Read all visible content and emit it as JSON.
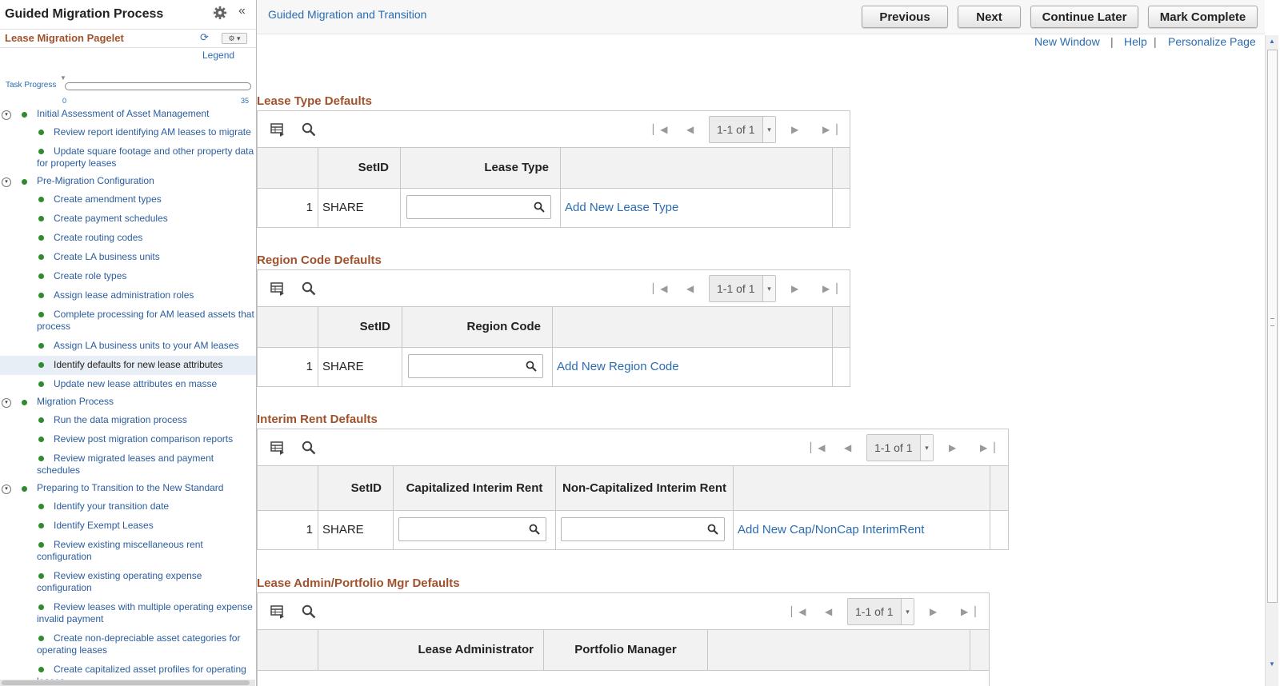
{
  "left_pane": {
    "title": "Guided Migration Process",
    "collapse_glyph": "«",
    "pagelet_title": "Lease Migration Pagelet",
    "refresh_glyph": "⟳",
    "options_glyph": "⚙ ▾",
    "legend": "Legend",
    "progress": {
      "label": "Task Progress",
      "min": "0",
      "max": "35",
      "value": 0
    },
    "tree": [
      {
        "level": 1,
        "label": "Initial Assessment of Asset Management",
        "toggle": "▾"
      },
      {
        "level": 2,
        "label": "Review report identifying AM leases to migrate"
      },
      {
        "level": 2,
        "label": "Update square footage and other property data for property leases"
      },
      {
        "level": 1,
        "label": "Pre-Migration Configuration",
        "toggle": "▾"
      },
      {
        "level": 2,
        "label": "Create amendment types"
      },
      {
        "level": 2,
        "label": "Create payment schedules"
      },
      {
        "level": 2,
        "label": "Create routing codes"
      },
      {
        "level": 2,
        "label": "Create LA business units"
      },
      {
        "level": 2,
        "label": "Create role types"
      },
      {
        "level": 2,
        "label": "Assign lease administration roles"
      },
      {
        "level": 2,
        "label": "Complete processing for AM leased assets that process"
      },
      {
        "level": 2,
        "label": "Assign LA business units to your AM leases"
      },
      {
        "level": 2,
        "label": "Identify defaults for new lease attributes",
        "selected": true
      },
      {
        "level": 2,
        "label": "Update new lease attributes en masse"
      },
      {
        "level": 1,
        "label": "Migration Process",
        "toggle": "▾"
      },
      {
        "level": 2,
        "label": "Run the data migration process"
      },
      {
        "level": 2,
        "label": "Review post migration comparison reports"
      },
      {
        "level": 2,
        "label": "Review migrated leases and payment schedules"
      },
      {
        "level": 1,
        "label": "Preparing to Transition to the New Standard",
        "toggle": "▾"
      },
      {
        "level": 2,
        "label": "Identify your transition date"
      },
      {
        "level": 2,
        "label": "Identify Exempt Leases"
      },
      {
        "level": 2,
        "label": "Review existing miscellaneous rent configuration"
      },
      {
        "level": 2,
        "label": "Review existing operating expense configuration"
      },
      {
        "level": 2,
        "label": "Review leases with multiple operating expense invalid payment"
      },
      {
        "level": 2,
        "label": "Create non-depreciable asset categories for operating leases"
      },
      {
        "level": 2,
        "label": "Create capitalized asset profiles for operating leases"
      }
    ]
  },
  "header": {
    "title": "Guided Migration and Transition",
    "buttons": {
      "previous": "Previous",
      "next": "Next",
      "continue_later": "Continue Later",
      "mark_complete": "Mark Complete"
    },
    "links": {
      "new_window": "New Window",
      "help": "Help",
      "personalize": "Personalize Page"
    },
    "separator": "|"
  },
  "nav_glyphs": {
    "first": "▏◀",
    "prev": "◀",
    "next": "▶",
    "last": "▶▕",
    "dropdown": "▾"
  },
  "sections": {
    "lease_type": {
      "title": "Lease Type Defaults",
      "pager": "1-1 of 1",
      "columns": [
        "SetID",
        "Lease Type"
      ],
      "row": {
        "num": "1",
        "setid": "SHARE",
        "value": "",
        "link": "Add New Lease Type"
      }
    },
    "region_code": {
      "title": "Region Code Defaults",
      "pager": "1-1 of 1",
      "columns": [
        "SetID",
        "Region Code"
      ],
      "row": {
        "num": "1",
        "setid": "SHARE",
        "value": "",
        "link": "Add New Region Code"
      }
    },
    "interim_rent": {
      "title": "Interim Rent Defaults",
      "pager": "1-1 of 1",
      "columns": [
        "SetID",
        "Capitalized Interim Rent",
        "Non-Capitalized Interim Rent"
      ],
      "row": {
        "num": "1",
        "setid": "SHARE",
        "value1": "",
        "value2": "",
        "link": "Add New Cap/NonCap InterimRent"
      }
    },
    "lease_admin": {
      "title": "Lease Admin/Portfolio Mgr Defaults",
      "pager": "1-1 of 1",
      "columns": [
        "Lease Administrator",
        "Portfolio Manager"
      ]
    }
  }
}
